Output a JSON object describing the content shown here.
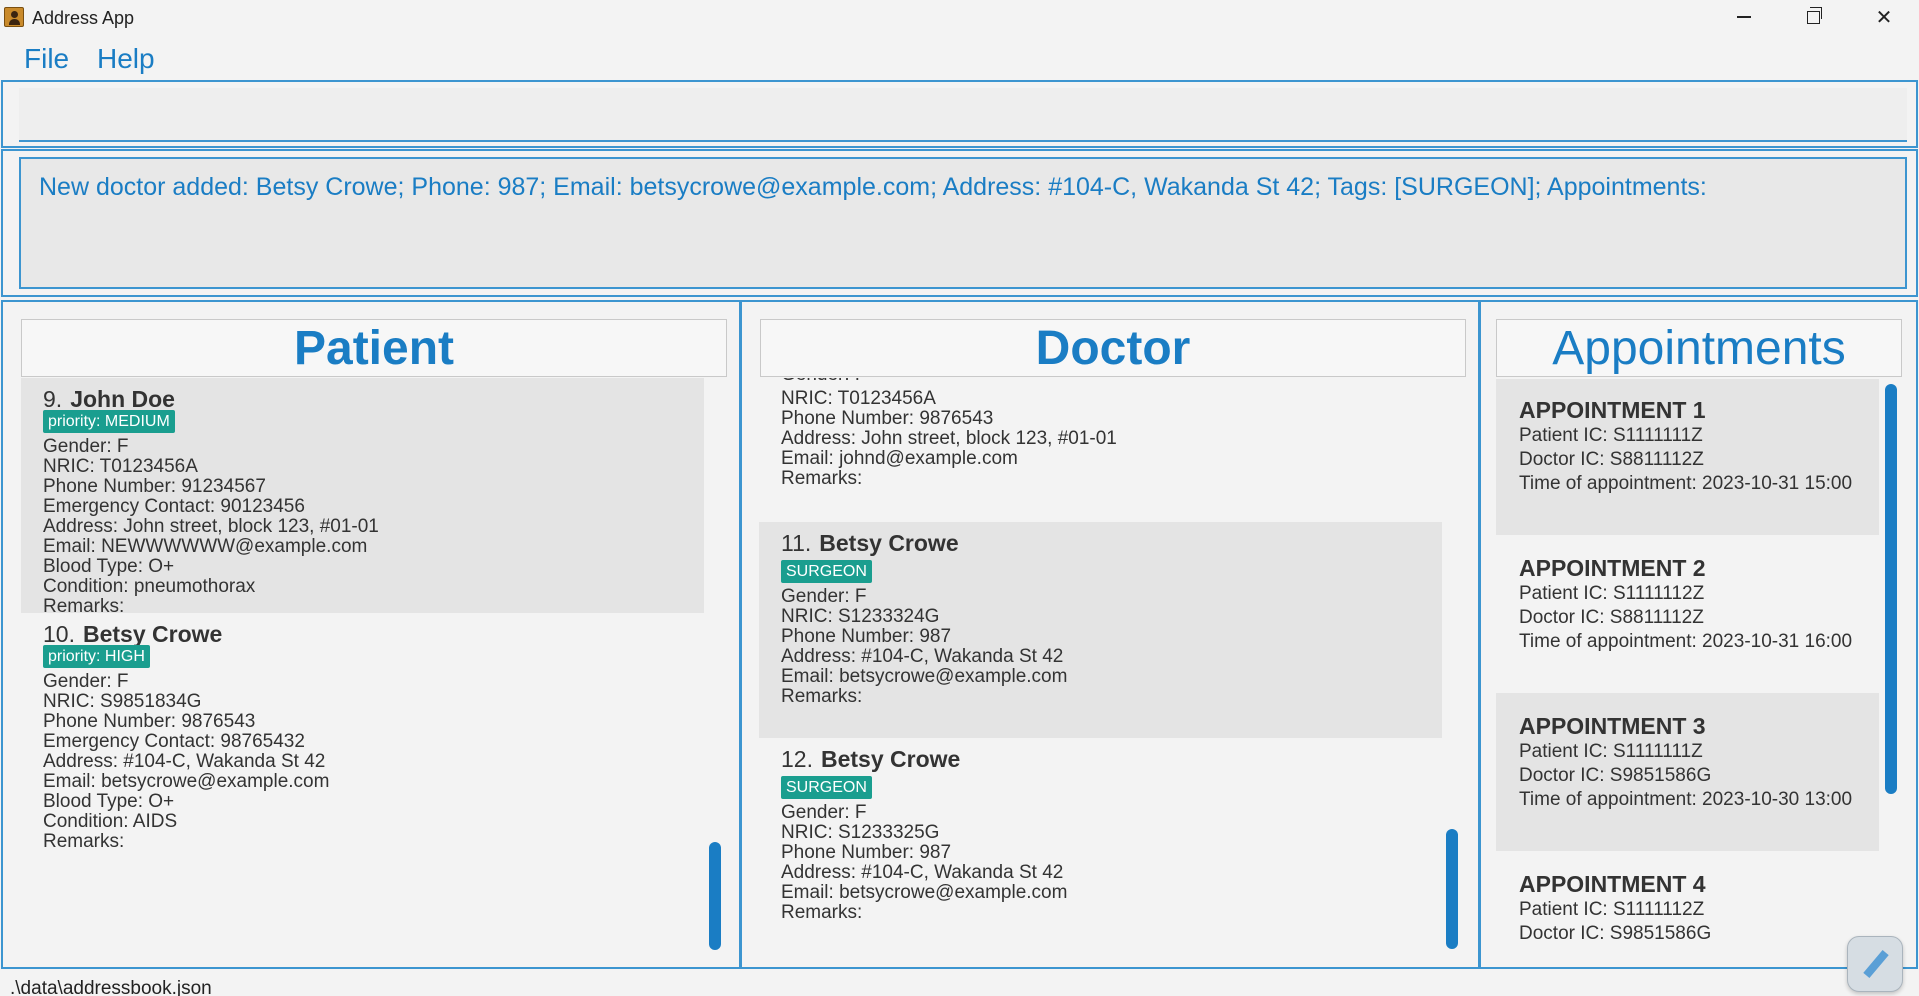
{
  "window": {
    "title": "Address App",
    "icon": "address-book-icon"
  },
  "menu": {
    "file": "File",
    "help": "Help"
  },
  "command": {
    "value": "",
    "placeholder": ""
  },
  "result": {
    "text": "New doctor added: Betsy Crowe; Phone: 987; Email: betsycrowe@example.com; Address: #104-C, Wakanda St 42; Tags: [SURGEON]; Appointments:"
  },
  "patient_panel": {
    "title": "Patient",
    "cards": [
      {
        "index": "9.",
        "name": "John Doe",
        "tag": "priority: MEDIUM",
        "gender": "Gender: F",
        "nric": "NRIC: T0123456A",
        "phone": "Phone Number: 91234567",
        "emergency": "Emergency Contact: 90123456",
        "address": "Address: John street, block 123, #01-01",
        "email": "Email: NEWWWWWW@example.com",
        "blood": "Blood Type: O+",
        "condition": "Condition: pneumothorax",
        "remarks": "Remarks:"
      },
      {
        "index": "10.",
        "name": "Betsy Crowe",
        "tag": "priority: HIGH",
        "gender": "Gender: F",
        "nric": "NRIC: S9851834G",
        "phone": "Phone Number: 9876543",
        "emergency": "Emergency Contact: 98765432",
        "address": "Address: #104-C, Wakanda St 42",
        "email": "Email: betsycrowe@example.com",
        "blood": "Blood Type: O+",
        "condition": "Condition: AIDS",
        "remarks": "Remarks:"
      }
    ]
  },
  "doctor_panel": {
    "title": "Doctor",
    "partial_card": {
      "gender": "Gender: F",
      "nric": "NRIC: T0123456A",
      "phone": "Phone Number: 9876543",
      "address": "Address: John street, block 123, #01-01",
      "email": "Email: johnd@example.com",
      "remarks": "Remarks:"
    },
    "cards": [
      {
        "index": "11.",
        "name": "Betsy Crowe",
        "tag": "SURGEON",
        "gender": "Gender: F",
        "nric": "NRIC: S1233324G",
        "phone": "Phone Number: 987",
        "address": "Address: #104-C, Wakanda St 42",
        "email": "Email: betsycrowe@example.com",
        "remarks": "Remarks:"
      },
      {
        "index": "12.",
        "name": "Betsy Crowe",
        "tag": "SURGEON",
        "gender": "Gender: F",
        "nric": "NRIC: S1233325G",
        "phone": "Phone Number: 987",
        "address": "Address: #104-C, Wakanda St 42",
        "email": "Email: betsycrowe@example.com",
        "remarks": "Remarks:"
      }
    ]
  },
  "appointment_panel": {
    "title": "Appointments",
    "cards": [
      {
        "title": "APPOINTMENT 1",
        "patient": "Patient IC: S1111111Z",
        "doctor": "Doctor IC: S8811112Z",
        "time": "Time of appointment: 2023-10-31 15:00"
      },
      {
        "title": "APPOINTMENT 2",
        "patient": "Patient IC: S1111112Z",
        "doctor": "Doctor IC: S8811112Z",
        "time": "Time of appointment: 2023-10-31 16:00"
      },
      {
        "title": "APPOINTMENT 3",
        "patient": "Patient IC: S1111111Z",
        "doctor": "Doctor IC: S9851586G",
        "time": "Time of appointment: 2023-10-30 13:00"
      },
      {
        "title": "APPOINTMENT 4",
        "patient": "Patient IC: S1111112Z",
        "doctor": "Doctor IC: S9851586G",
        "time": ""
      }
    ]
  },
  "status": {
    "path": ".\\data\\addressbook.json"
  },
  "colors": {
    "accent": "#1a7dc4",
    "border": "#3c95d0",
    "tag": "#1a9e8f"
  }
}
